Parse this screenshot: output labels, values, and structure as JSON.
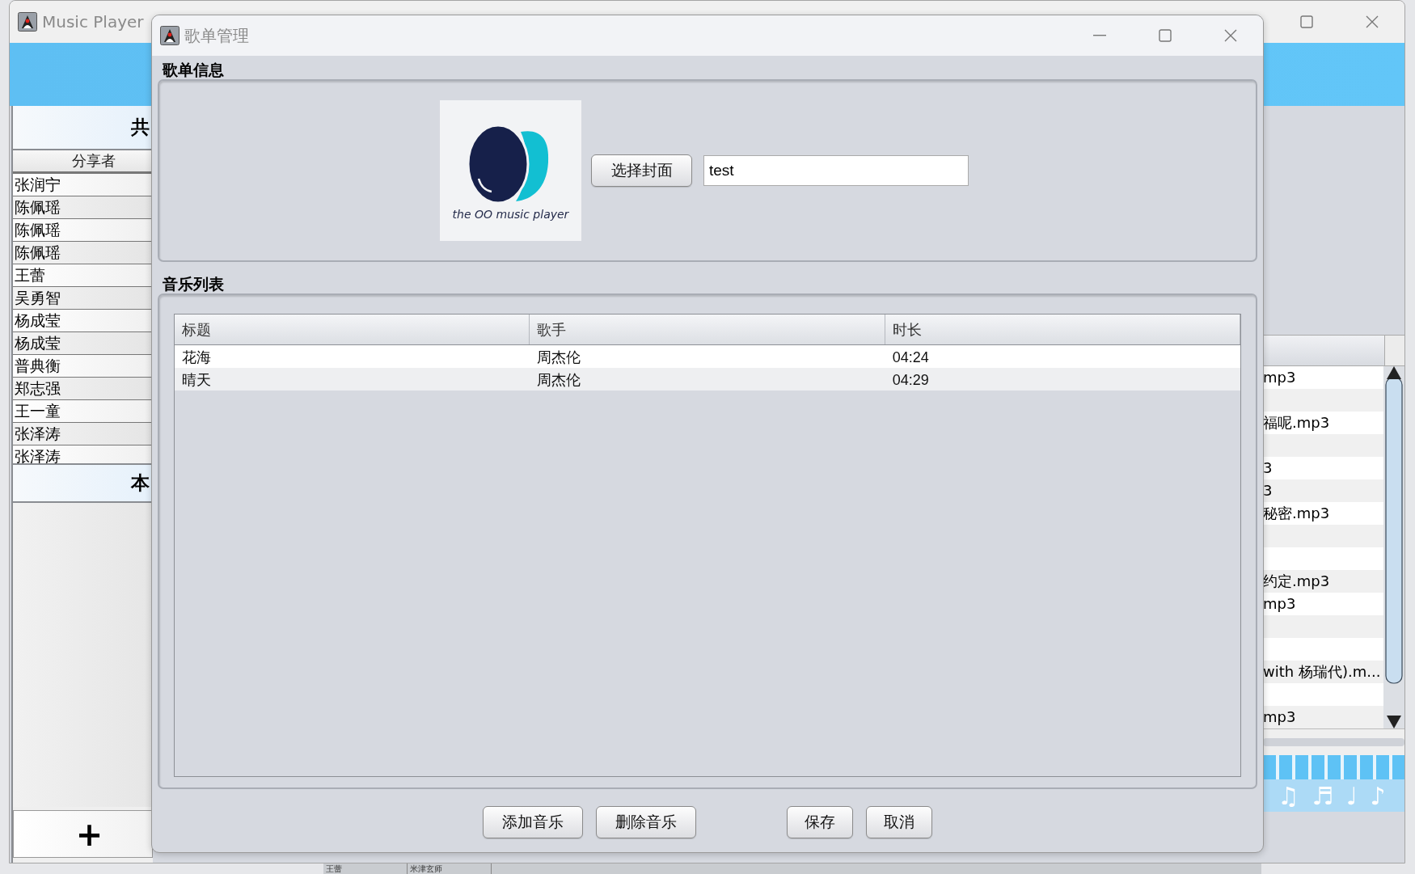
{
  "main_window": {
    "title": "Music Player",
    "shared_header": "共",
    "shared_table": {
      "column": "分享者",
      "rows": [
        "张润宁",
        "陈佩瑶",
        "陈佩瑶",
        "陈佩瑶",
        "王蕾",
        "吴勇智",
        "杨成莹",
        "杨成莹",
        "普典衡",
        "郑志强",
        "王一童",
        "张泽涛",
        "张泽涛"
      ]
    },
    "local_header": "本",
    "add_button": "+",
    "song_list": [
      {
        "kind": "file",
        "text": "mp3"
      },
      {
        "kind": "blank"
      },
      {
        "kind": "file",
        "text": "福呢.mp3"
      },
      {
        "kind": "blank"
      },
      {
        "kind": "file",
        "text": "3"
      },
      {
        "kind": "file",
        "text": "3"
      },
      {
        "kind": "file",
        "text": "秘密.mp3"
      },
      {
        "kind": "blank"
      },
      {
        "kind": "blank"
      },
      {
        "kind": "file",
        "text": "约定.mp3"
      },
      {
        "kind": "file",
        "text": "mp3"
      },
      {
        "kind": "blank"
      },
      {
        "kind": "blank"
      },
      {
        "kind": "file",
        "text": "with 杨瑞代).m..."
      },
      {
        "kind": "blank"
      },
      {
        "kind": "file",
        "text": "mp3"
      }
    ],
    "notes": "♫ ♬ ♩ ♪"
  },
  "dialog": {
    "title": "歌单管理",
    "info_section": {
      "label": "歌单信息",
      "cover": {
        "caption": "the OO music player"
      },
      "choose_cover_button": "选择封面",
      "name_field": {
        "value": "test"
      }
    },
    "music_section": {
      "label": "音乐列表",
      "columns": [
        "标题",
        "歌手",
        "时长"
      ],
      "rows": [
        {
          "title": "花海",
          "singer": "周杰伦",
          "duration": "04:24"
        },
        {
          "title": "晴天",
          "singer": "周杰伦",
          "duration": "04:29"
        }
      ]
    },
    "button_groups": [
      [
        "添加音乐",
        "删除音乐"
      ],
      [
        "保存",
        "取消"
      ]
    ]
  },
  "background_window": {
    "cells": [
      "王蕾",
      "米津玄师"
    ]
  }
}
